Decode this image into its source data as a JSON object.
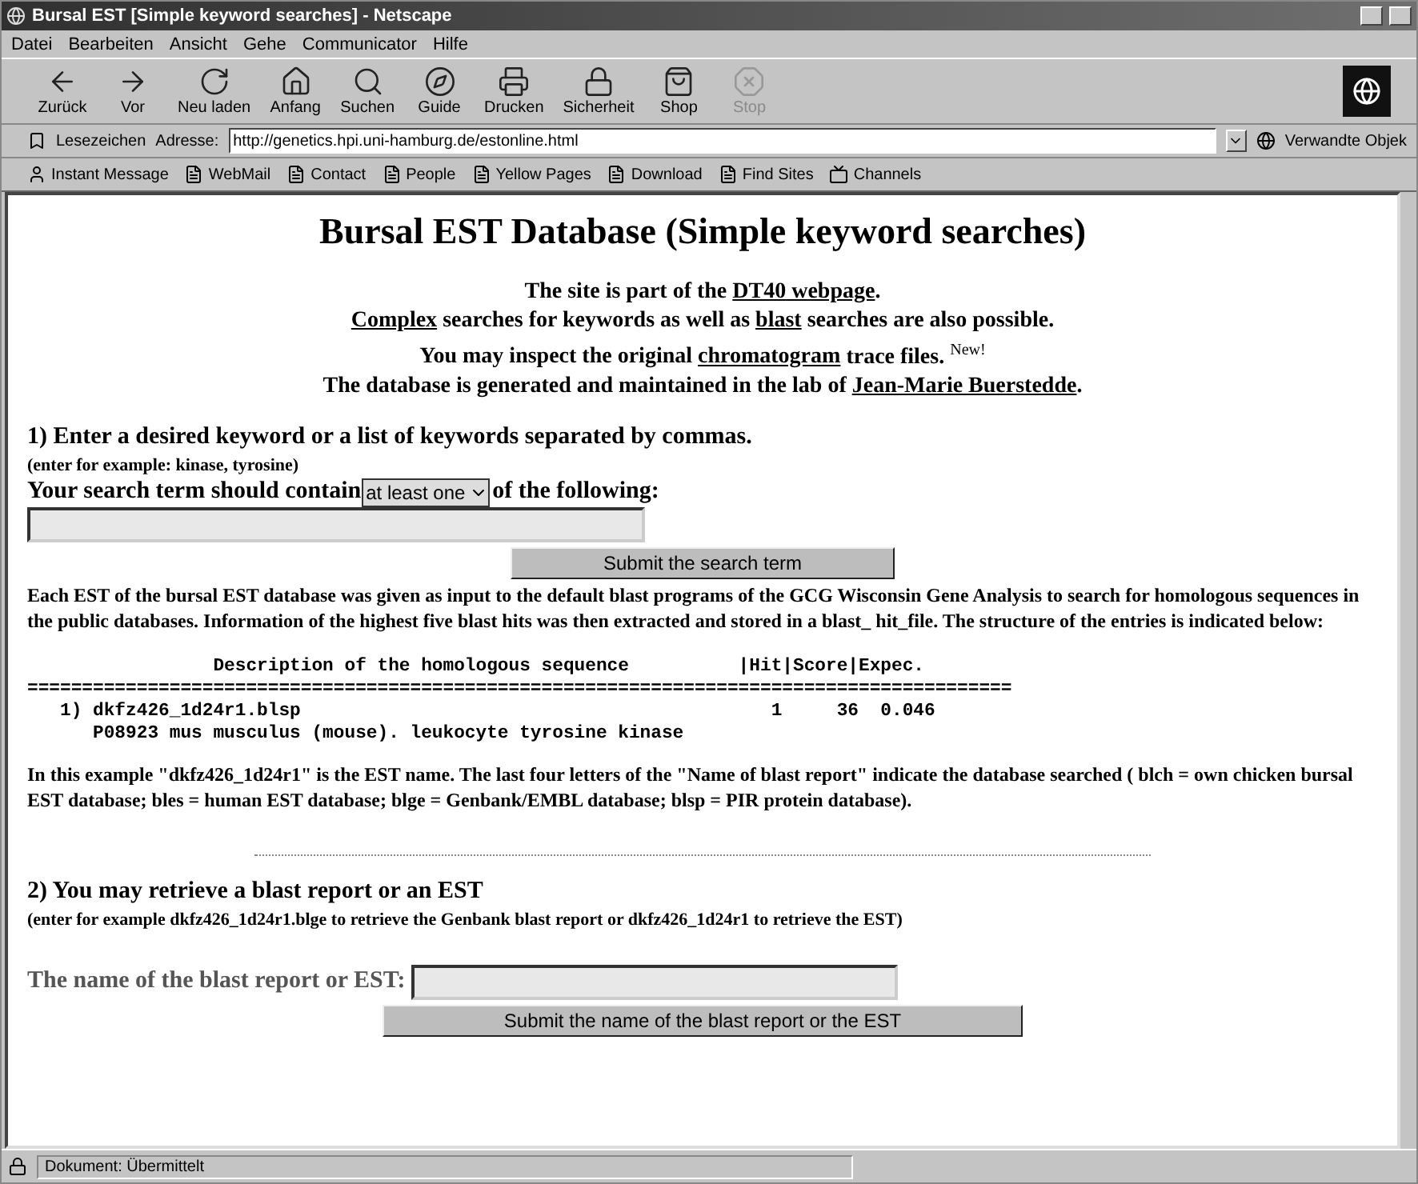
{
  "window": {
    "title": "Bursal EST [Simple keyword searches] - Netscape"
  },
  "menu": [
    "Datei",
    "Bearbeiten",
    "Ansicht",
    "Gehe",
    "Communicator",
    "Hilfe"
  ],
  "toolbar": [
    {
      "kind": "back",
      "label": "Zurück",
      "disabled": false
    },
    {
      "kind": "forward",
      "label": "Vor",
      "disabled": false
    },
    {
      "kind": "reload",
      "label": "Neu laden",
      "disabled": false
    },
    {
      "kind": "home",
      "label": "Anfang",
      "disabled": false
    },
    {
      "kind": "search",
      "label": "Suchen",
      "disabled": false
    },
    {
      "kind": "guide",
      "label": "Guide",
      "disabled": false
    },
    {
      "kind": "print",
      "label": "Drucken",
      "disabled": false
    },
    {
      "kind": "security",
      "label": "Sicherheit",
      "disabled": false
    },
    {
      "kind": "shop",
      "label": "Shop",
      "disabled": false
    },
    {
      "kind": "stop",
      "label": "Stop",
      "disabled": true
    }
  ],
  "location_bar": {
    "bookmarks_label": "Lesezeichen",
    "address_label": "Adresse:",
    "url": "http://genetics.hpi.uni-hamburg.de/estonline.html",
    "related_label": "Verwandte Objek"
  },
  "personal_toolbar": [
    {
      "kind": "person",
      "label": "Instant Message"
    },
    {
      "kind": "page",
      "label": "WebMail"
    },
    {
      "kind": "page",
      "label": "Contact"
    },
    {
      "kind": "page",
      "label": "People"
    },
    {
      "kind": "page",
      "label": "Yellow Pages"
    },
    {
      "kind": "page",
      "label": "Download"
    },
    {
      "kind": "page",
      "label": "Find Sites"
    },
    {
      "kind": "channels",
      "label": "Channels"
    }
  ],
  "page": {
    "heading": "Bursal EST Database (Simple keyword searches)",
    "intro_lines": [
      [
        {
          "text": "The site is part of the ",
          "link": false
        },
        {
          "text": "DT40 webpage",
          "link": true
        },
        {
          "text": ".",
          "link": false
        }
      ],
      [
        {
          "text": "Complex",
          "link": true
        },
        {
          "text": " searches for keywords as well as ",
          "link": false
        },
        {
          "text": "blast",
          "link": true
        },
        {
          "text": " searches are also possible.",
          "link": false
        }
      ],
      [
        {
          "text": "You may inspect the original ",
          "link": false
        },
        {
          "text": "chromatogram",
          "link": true
        },
        {
          "text": " trace files. $^{New!}$",
          "link": false
        }
      ],
      [
        {
          "text": "The database is generated and maintained in the lab of ",
          "link": false
        },
        {
          "text": "Jean-Marie Buerstedde",
          "link": true
        },
        {
          "text": ".",
          "link": false
        }
      ]
    ],
    "section1": {
      "heading": "1) Enter a desired keyword or a list of keywords separated by commas.",
      "hint": "(enter for example: kinase, tyrosine)",
      "prompt_before": "Your search term should contain",
      "select_value": "at least one",
      "prompt_after": "of the following:",
      "submit": "Submit the search term"
    },
    "description": "Each EST of the bursal EST database was given as input to the default blast programs of the GCG Wisconsin Gene Analysis to search for homologous sequences in the public databases. Information of the highest five blast hits was then extracted and stored in a blast_ hit_file. The structure of the entries is indicated below:",
    "example_lines": [
      {
        "kind": "header",
        "text": "                 Description of the homologous sequence          |Hit|Score|Expec."
      },
      {
        "kind": "rule",
        "text": "=========================================================================================="
      },
      {
        "kind": "entry",
        "text": "   1) dkfz426_1d24r1.blsp                                           1     36  0.046"
      },
      {
        "kind": "entry",
        "text": "      P08923 mus musculus (mouse). leukocyte tyrosine kinase"
      }
    ],
    "explanation": "In this example \"dkfz426_1d24r1\" is the EST name. The last four letters of the \"Name of blast report\" indicate the database searched ( blch = own chicken bursal EST database; bles = human EST database; blge = Genbank/EMBL database; blsp = PIR protein database).",
    "section2": {
      "heading": "2) You may retrieve a blast report or an EST",
      "hint": "(enter for example dkfz426_1d24r1.blge to retrieve the Genbank blast report or dkfz426_1d24r1 to retrieve the EST)",
      "field_label": "The name of the blast report or EST:",
      "submit": "Submit the name of the blast report or the EST"
    }
  },
  "status_bar": {
    "text": "Dokument: Übermittelt"
  }
}
